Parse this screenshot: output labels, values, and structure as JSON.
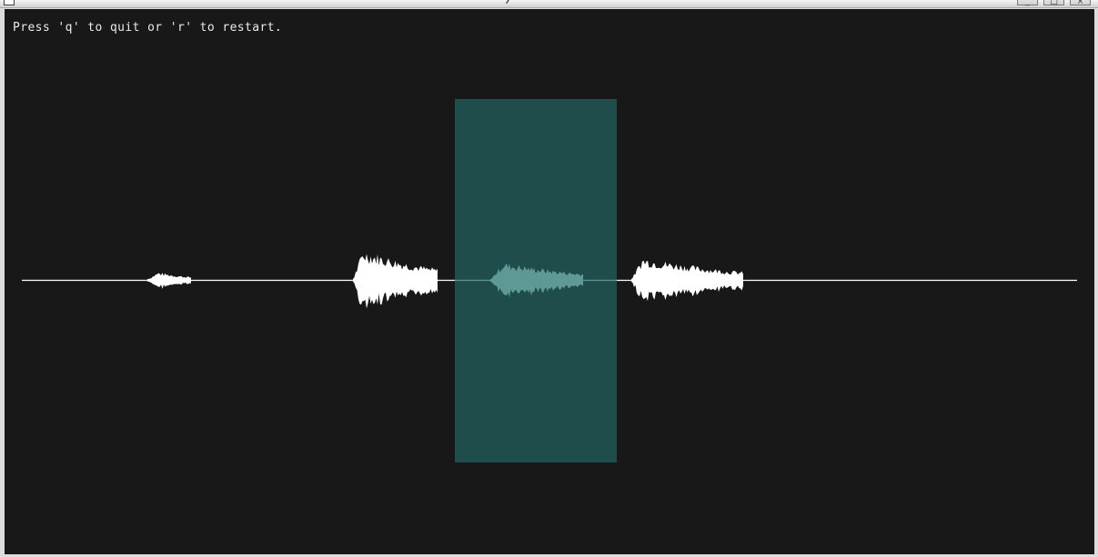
{
  "window": {
    "title_glyph": "y",
    "controls": [
      {
        "name": "minimize",
        "glyph": "_"
      },
      {
        "name": "maximize",
        "glyph": "□"
      },
      {
        "name": "close",
        "glyph": "×"
      }
    ]
  },
  "help_text": "Press 'q' to quit or 'r' to restart.",
  "colors": {
    "background": "#181818",
    "waveform": "#ffffff",
    "selection_fill": "#1e4d4c",
    "selected_waveform": "#5f9995"
  }
}
